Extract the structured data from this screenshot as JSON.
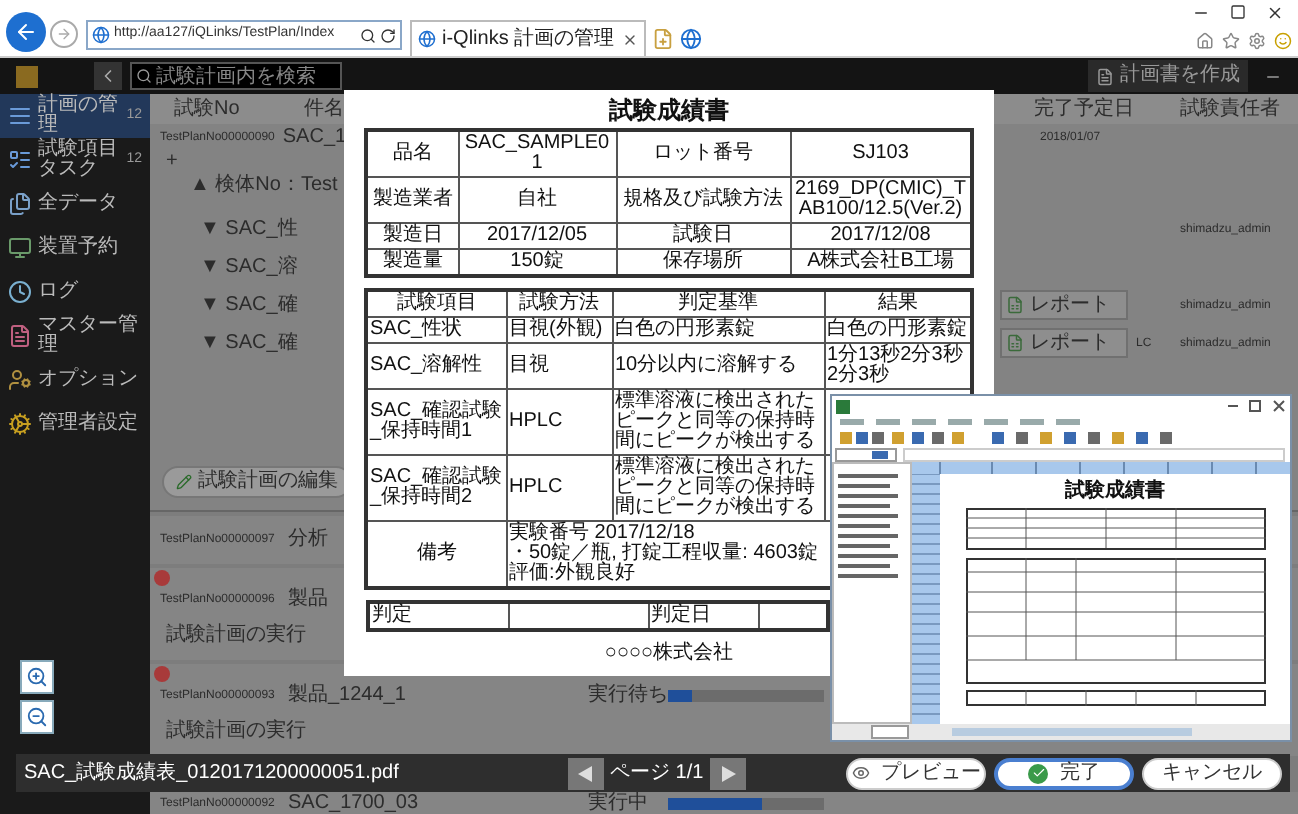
{
  "browser": {
    "address": "http://aa127/iQLinks/TestPlan/Index",
    "tab_title": "i-Qlinks 計画の管理"
  },
  "app": {
    "search_placeholder": "試験計画内を検索",
    "create_button": "計画書を作成",
    "sidebar": [
      {
        "label": "計画の管理",
        "count": "12",
        "selected": true
      },
      {
        "label": "試験項目タスク",
        "count": "12",
        "selected": false
      },
      {
        "label": "全データ",
        "selected": false
      },
      {
        "label": "装置予約",
        "selected": false
      },
      {
        "label": "ログ",
        "selected": false
      },
      {
        "label": "マスター管理",
        "selected": false
      },
      {
        "label": "オプション",
        "selected": false
      },
      {
        "label": "管理者設定",
        "selected": false
      }
    ],
    "columns_left": [
      "試験No",
      "件名"
    ],
    "columns_right": [
      "完了予定日",
      "試験責任者"
    ],
    "expanded_plan": {
      "no": "TestPlanNo00000090",
      "name": "SAC_1",
      "date": "2018/01/07",
      "expand_mark": "+",
      "sample": "▲ 検体No：Test",
      "items": [
        {
          "name": "▼ SAC_性",
          "owner": "shimadzu_admin"
        },
        {
          "name": "▼ SAC_溶"
        },
        {
          "name": "▼ SAC_確",
          "report": "レポート",
          "owner": "shimadzu_admin"
        },
        {
          "name": "▼ SAC_確",
          "report": "レポート",
          "method": "LC",
          "owner": "shimadzu_admin"
        }
      ],
      "edit_button": "試験計画の編集"
    },
    "plans": [
      {
        "no": "TestPlanNo00000097",
        "name": "分析",
        "alert": false
      },
      {
        "no": "TestPlanNo00000096",
        "name": "製品",
        "alert": true,
        "action": "試験計画の実行"
      },
      {
        "no": "TestPlanNo00000093",
        "name": "製品_1244_1",
        "alert": true,
        "action": "試験計画の実行",
        "status": "実行待ち",
        "level": 0.15
      },
      {
        "no": "TestPlanNo00000092",
        "name": "SAC_1700_03",
        "alert": false,
        "status": "実行中",
        "level": 0.6
      }
    ]
  },
  "document": {
    "title": "試験成績書",
    "header": [
      [
        "品名",
        "SAC_SAMPLE01",
        "ロット番号",
        "SJ103"
      ],
      [
        "製造業者",
        "自社",
        "規格及び試験方法",
        "2169_DP(CMIC)_TAB100/12.5(Ver.2)"
      ],
      [
        "製造日",
        "2017/12/05",
        "試験日",
        "2017/12/08"
      ],
      [
        "製造量",
        "150錠",
        "保存場所",
        "A株式会社B工場"
      ]
    ],
    "test_columns": [
      "試験項目",
      "試験方法",
      "判定基準",
      "結果"
    ],
    "tests": [
      {
        "item": "SAC_性状",
        "method": "目視(外観)",
        "criterion": "白色の円形素錠",
        "result": "白色の円形素錠"
      },
      {
        "item": "SAC_溶解性",
        "method": "目視",
        "criterion": "10分以内に溶解する",
        "result": "1分13秒2分3秒2分3秒"
      },
      {
        "item": "SAC_確認試験_保持時間1",
        "method": "HPLC",
        "criterion": "標準溶液に検出されたピークと同等の保持時間にピークが検出する"
      },
      {
        "item": "SAC_確認試験_保持時間2",
        "method": "HPLC",
        "criterion": "標準溶液に検出されたピークと同等の保持時間にピークが検出する"
      }
    ],
    "remarks_label": "備考",
    "remarks": [
      "実験番号 2017/12/18",
      "・50錠／瓶, 打錠工程収量: 4603錠",
      "評価:外観良好"
    ],
    "judge": [
      "判定",
      "判定日"
    ],
    "company": "○○○○株式会社"
  },
  "spreadsheet": {
    "report_title": "試験成績書"
  },
  "viewer": {
    "file_name": "SAC_試験成績表_0120171200000051.pdf",
    "page": "ページ 1/1",
    "buttons": [
      {
        "label": "プレビュー",
        "kind": "preview"
      },
      {
        "label": "完了",
        "kind": "done"
      },
      {
        "label": "キャンセル",
        "kind": "cancel"
      }
    ]
  }
}
